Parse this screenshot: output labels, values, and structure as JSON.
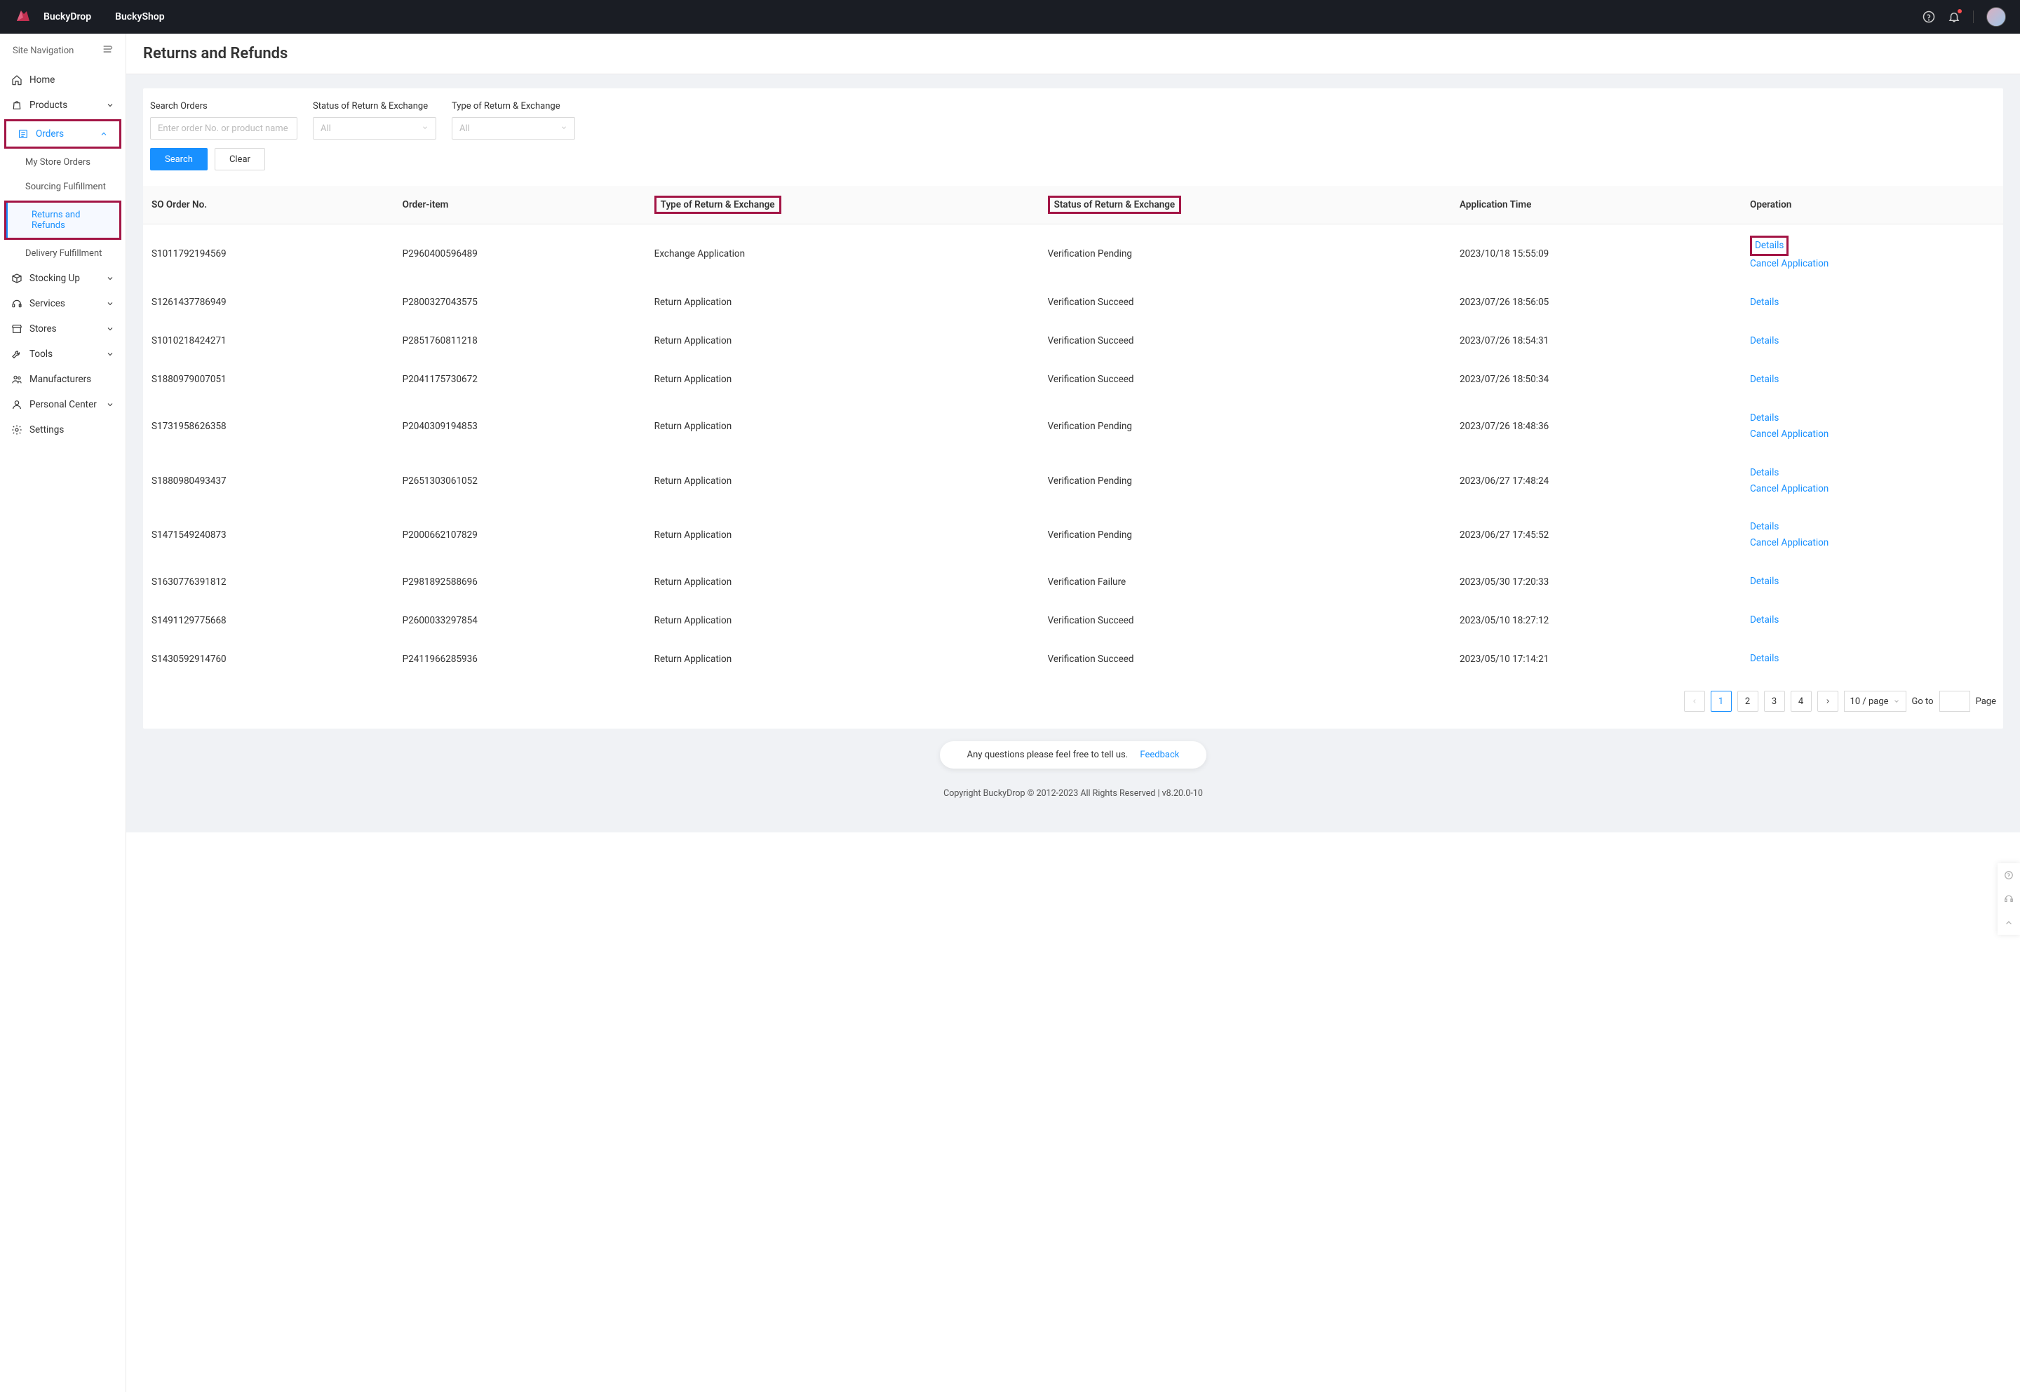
{
  "header": {
    "brand1": "BuckyDrop",
    "brand2": "BuckyShop"
  },
  "sidebar": {
    "title": "Site Navigation",
    "home": "Home",
    "products": "Products",
    "orders": "Orders",
    "orders_sub": {
      "my_store_orders": "My Store Orders",
      "sourcing": "Sourcing Fulfillment",
      "returns": "Returns and Refunds",
      "delivery": "Delivery Fulfillment"
    },
    "stocking": "Stocking Up",
    "services": "Services",
    "stores": "Stores",
    "tools": "Tools",
    "manufacturers": "Manufacturers",
    "personal_center": "Personal Center",
    "settings": "Settings"
  },
  "page_title": "Returns and Refunds",
  "filters": {
    "search_label": "Search Orders",
    "search_placeholder": "Enter order No. or product name to ...",
    "status_label": "Status of Return & Exchange",
    "status_value": "All",
    "type_label": "Type of Return & Exchange",
    "type_value": "All",
    "search_btn": "Search",
    "clear_btn": "Clear"
  },
  "columns": {
    "so_no": "SO Order No.",
    "order_item": "Order-item",
    "type": "Type of Return & Exchange",
    "status": "Status of Return & Exchange",
    "app_time": "Application Time",
    "operation": "Operation"
  },
  "ops": {
    "details": "Details",
    "cancel": "Cancel Application"
  },
  "rows": [
    {
      "so": "S1011792194569",
      "item": "P2960400596489",
      "type": "Exchange Application",
      "status": "Verification Pending",
      "time": "2023/10/18 15:55:09",
      "cancel": true,
      "h": true
    },
    {
      "so": "S1261437786949",
      "item": "P2800327043575",
      "type": "Return Application",
      "status": "Verification Succeed",
      "time": "2023/07/26 18:56:05",
      "cancel": false
    },
    {
      "so": "S1010218424271",
      "item": "P2851760811218",
      "type": "Return Application",
      "status": "Verification Succeed",
      "time": "2023/07/26 18:54:31",
      "cancel": false
    },
    {
      "so": "S1880979007051",
      "item": "P2041175730672",
      "type": "Return Application",
      "status": "Verification Succeed",
      "time": "2023/07/26 18:50:34",
      "cancel": false
    },
    {
      "so": "S1731958626358",
      "item": "P2040309194853",
      "type": "Return Application",
      "status": "Verification Pending",
      "time": "2023/07/26 18:48:36",
      "cancel": true
    },
    {
      "so": "S1880980493437",
      "item": "P2651303061052",
      "type": "Return Application",
      "status": "Verification Pending",
      "time": "2023/06/27 17:48:24",
      "cancel": true
    },
    {
      "so": "S1471549240873",
      "item": "P2000662107829",
      "type": "Return Application",
      "status": "Verification Pending",
      "time": "2023/06/27 17:45:52",
      "cancel": true
    },
    {
      "so": "S1630776391812",
      "item": "P2981892588696",
      "type": "Return Application",
      "status": "Verification Failure",
      "time": "2023/05/30 17:20:33",
      "cancel": false
    },
    {
      "so": "S1491129775668",
      "item": "P2600033297854",
      "type": "Return Application",
      "status": "Verification Succeed",
      "time": "2023/05/10 18:27:12",
      "cancel": false
    },
    {
      "so": "S1430592914760",
      "item": "P2411966285936",
      "type": "Return Application",
      "status": "Verification Succeed",
      "time": "2023/05/10 17:14:21",
      "cancel": false
    }
  ],
  "pagination": {
    "pages": [
      "1",
      "2",
      "3",
      "4"
    ],
    "active": "1",
    "page_size": "10 / page",
    "goto_label": "Go to",
    "page_suffix": "Page"
  },
  "feedback": {
    "text": "Any questions please feel free to tell us.",
    "link": "Feedback"
  },
  "copyright": "Copyright BuckyDrop © 2012-2023 All Rights Reserved | v8.20.0-10"
}
